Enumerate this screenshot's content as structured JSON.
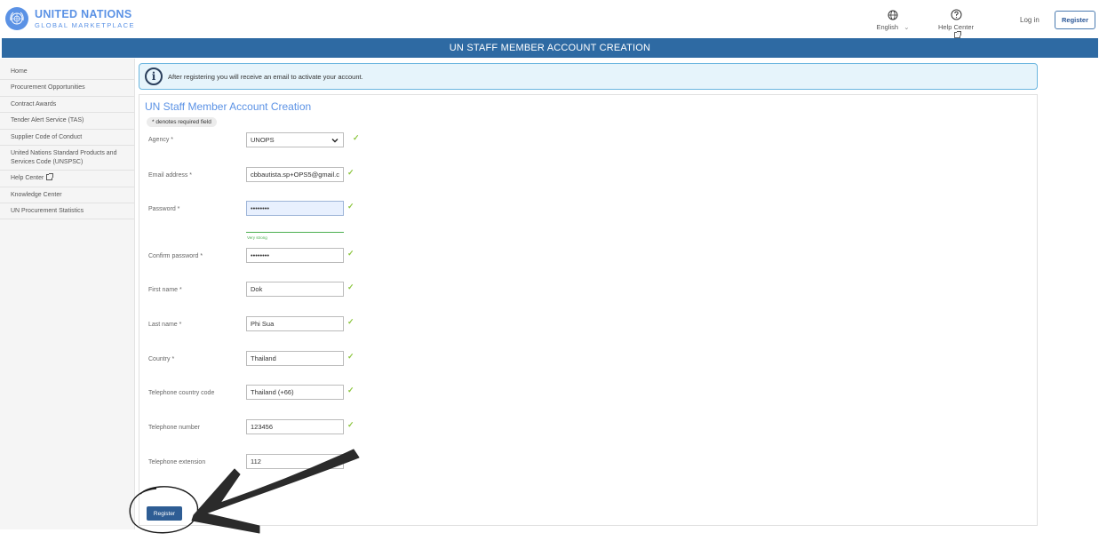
{
  "header": {
    "logo_line1": "UNITED NATIONS",
    "logo_line2": "GLOBAL MARKETPLACE",
    "language": "English",
    "help": "Help Center",
    "login": "Log in",
    "register": "Register"
  },
  "page_title": "UN STAFF MEMBER ACCOUNT CREATION",
  "sidebar": {
    "items": [
      {
        "label": "Home"
      },
      {
        "label": "Procurement Opportunities"
      },
      {
        "label": "Contract Awards"
      },
      {
        "label": "Tender Alert Service (TAS)"
      },
      {
        "label": "Supplier Code of Conduct"
      },
      {
        "label": "United Nations Standard Products and Services Code (UNSPSC)"
      },
      {
        "label": "Help Center"
      },
      {
        "label": "Knowledge Center"
      },
      {
        "label": "UN Procurement Statistics"
      }
    ]
  },
  "info": "After registering you will receive an email to activate your account.",
  "form": {
    "title": "UN Staff Member Account Creation",
    "required_note": "* denotes required field",
    "fields": {
      "agency": {
        "label": "Agency *",
        "value": "UNOPS"
      },
      "email": {
        "label": "Email address *",
        "value": "cbbautista.sp+OPS5@gmail.c"
      },
      "password": {
        "label": "Password *",
        "value": "••••••••"
      },
      "strength": "Very strong",
      "confirm_password": {
        "label": "Confirm password *",
        "value": "••••••••"
      },
      "first_name": {
        "label": "First name *",
        "value": "Dok"
      },
      "last_name": {
        "label": "Last name *",
        "value": "Phi Sua"
      },
      "country": {
        "label": "Country *",
        "value": "Thailand"
      },
      "phone_code": {
        "label": "Telephone country code",
        "value": "Thailand (+66)"
      },
      "phone_number": {
        "label": "Telephone number",
        "value": "123456"
      },
      "phone_ext": {
        "label": "Telephone extension",
        "value": "112"
      }
    },
    "check_mark": "✓",
    "submit": "Register"
  },
  "colors": {
    "brand_blue": "#2e6aa3",
    "link_blue": "#5b92e5",
    "check_green": "#8cc63f",
    "info_bg": "#e6f4fb"
  },
  "icons": [
    "un-emblem-icon",
    "globe-icon",
    "chevron-down-icon",
    "help-circle-icon",
    "external-link-icon",
    "info-icon",
    "check-icon"
  ]
}
